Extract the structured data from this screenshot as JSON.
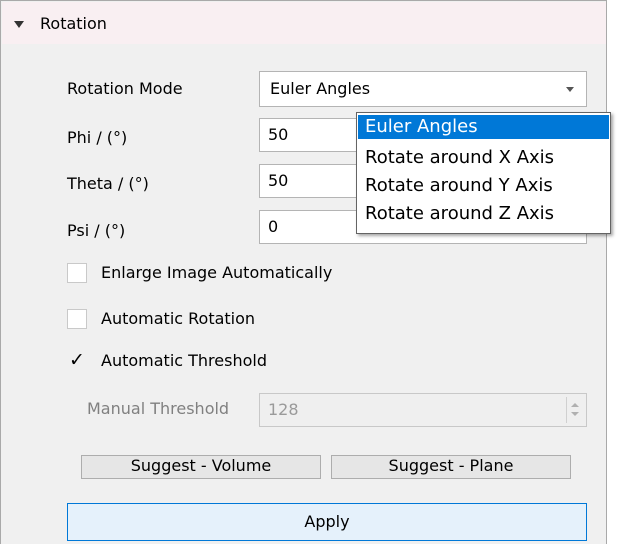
{
  "section": {
    "title": "Rotation"
  },
  "rotation_mode": {
    "label": "Rotation Mode",
    "value": "Euler Angles",
    "options": [
      "Euler Angles",
      "Rotate around X Axis",
      "Rotate around Y Axis",
      "Rotate around Z Axis"
    ],
    "selected_index": 0
  },
  "fields": {
    "phi": {
      "label": "Phi / (°)",
      "value": "50"
    },
    "theta": {
      "label": "Theta / (°)",
      "value": "50"
    },
    "psi": {
      "label": "Psi / (°)",
      "value": "0"
    }
  },
  "checkboxes": {
    "enlarge": {
      "label": "Enlarge Image Automatically",
      "checked": false
    },
    "auto_rotation": {
      "label": "Automatic Rotation",
      "checked": false
    },
    "auto_threshold": {
      "label": "Automatic Threshold",
      "checked": true,
      "mark": "✓"
    }
  },
  "manual_threshold": {
    "label": "Manual Threshold",
    "value": "128",
    "enabled": false
  },
  "buttons": {
    "suggest_volume": "Suggest - Volume",
    "suggest_plane": "Suggest - Plane",
    "apply": "Apply"
  },
  "colors": {
    "selection": "#0078d7",
    "header_bg": "#f9eff2",
    "panel_bg": "#f0f0f0"
  }
}
